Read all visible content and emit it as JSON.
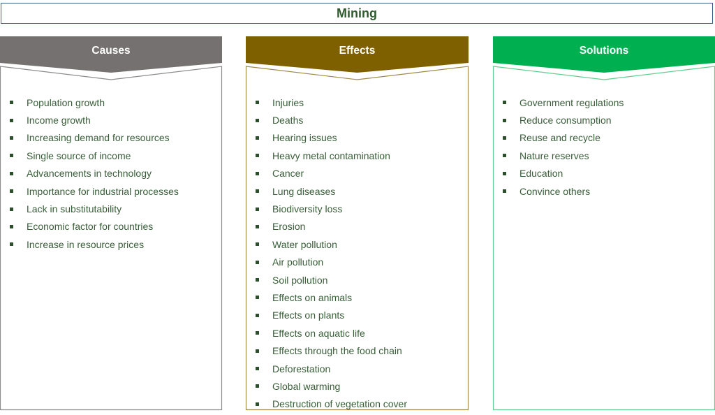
{
  "title": "Mining",
  "colors": {
    "causes": "#767171",
    "effects": "#7f6000",
    "solutions": "#00b050",
    "causes_border": "#8c8c8c",
    "effects_border": "#a08a4a",
    "solutions_border": "#5fd08e",
    "text": "#385d38",
    "title_border": "#3f5b8c"
  },
  "columns": {
    "causes": {
      "label": "Causes",
      "items": [
        "Population growth",
        "Income growth",
        "Increasing demand for resources",
        "Single source of income",
        "Advancements in technology",
        "Importance for industrial processes",
        "Lack in substitutability",
        "Economic factor for countries",
        "Increase in resource prices"
      ]
    },
    "effects": {
      "label": "Effects",
      "items": [
        "Injuries",
        "Deaths",
        "Hearing issues",
        "Heavy metal contamination",
        "Cancer",
        "Lung diseases",
        "Biodiversity loss",
        "Erosion",
        "Water pollution",
        "Air pollution",
        "Soil pollution",
        "Effects on animals",
        "Effects on plants",
        "Effects on aquatic life",
        "Effects through the food chain",
        "Deforestation",
        "Global warming",
        "Destruction of vegetation cover"
      ]
    },
    "solutions": {
      "label": "Solutions",
      "items": [
        "Government regulations",
        "Reduce consumption",
        "Reuse and recycle",
        "Nature reserves",
        "Education",
        "Convince others"
      ]
    }
  }
}
